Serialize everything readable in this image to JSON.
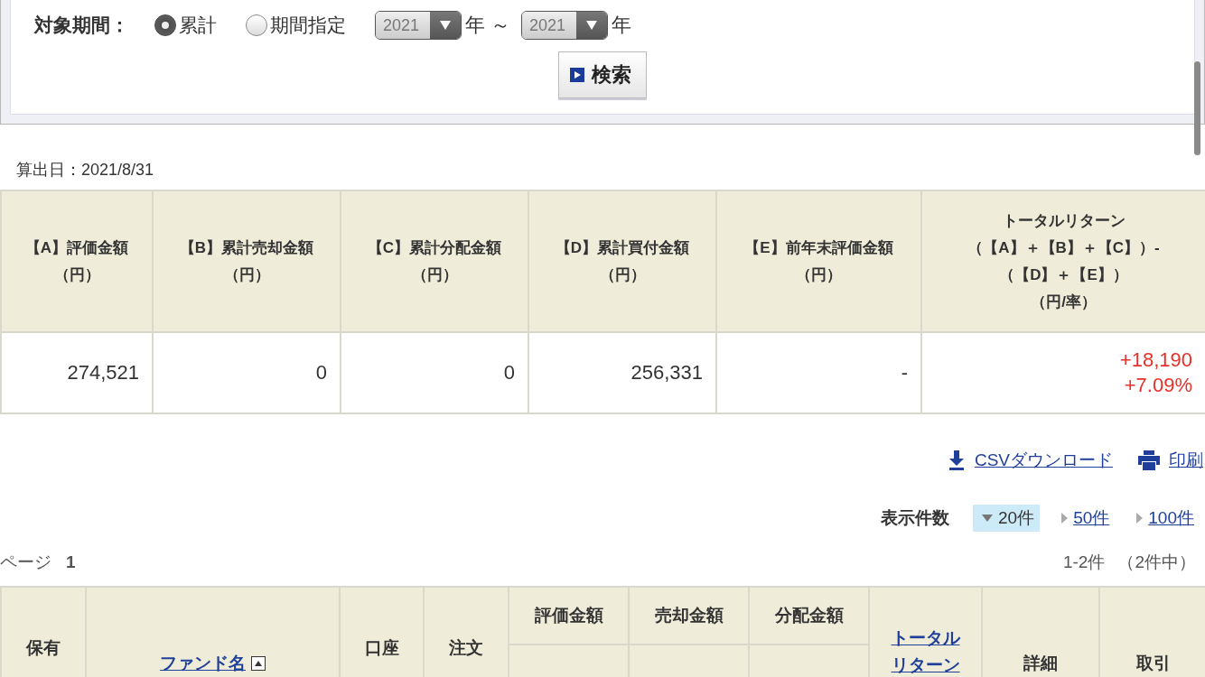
{
  "filter": {
    "label": "対象期間：",
    "options": [
      {
        "label": "累計",
        "selected": true
      },
      {
        "label": "期間指定",
        "selected": false
      }
    ],
    "from_year": "2021",
    "from_unit": "年",
    "separator": "～",
    "to_year": "2021",
    "to_unit": "年",
    "search_button": "検索"
  },
  "calc_date": "算出日：2021/8/31",
  "summary": {
    "columns": [
      {
        "lines": [
          "【A】評価金額",
          "（円）"
        ]
      },
      {
        "lines": [
          "【B】累計売却金額",
          "（円）"
        ]
      },
      {
        "lines": [
          "【C】累計分配金額",
          "（円）"
        ]
      },
      {
        "lines": [
          "【D】累計買付金額",
          "（円）"
        ]
      },
      {
        "lines": [
          "【E】前年末評価金額",
          "（円）"
        ]
      },
      {
        "lines": [
          "トータルリターン",
          "（【A】＋【B】＋【C】）-",
          "（【D】＋【E】）",
          "（円/率）"
        ]
      }
    ],
    "row": [
      {
        "kind": "plain",
        "lines": [
          "274,521"
        ]
      },
      {
        "kind": "plain",
        "lines": [
          "0"
        ]
      },
      {
        "kind": "plain",
        "lines": [
          "0"
        ]
      },
      {
        "kind": "plain",
        "lines": [
          "256,331"
        ]
      },
      {
        "kind": "plain",
        "lines": [
          "-"
        ]
      },
      {
        "kind": "gain",
        "lines": [
          "+18,190",
          "+7.09%"
        ]
      }
    ]
  },
  "actions": [
    {
      "kind": "download",
      "label": "CSVダウンロード"
    },
    {
      "kind": "print",
      "label": "印刷"
    }
  ],
  "page_size": {
    "label": "表示件数",
    "options": [
      {
        "label": "20件",
        "selected": true
      },
      {
        "label": "50件",
        "selected": false
      },
      {
        "label": "100件",
        "selected": false
      }
    ]
  },
  "pager": {
    "label": "ページ",
    "current": "1",
    "range": "1-2件",
    "total": "（2件中）"
  },
  "fund_table": {
    "columns": [
      {
        "lines": [
          "保有"
        ],
        "link": false
      },
      {
        "lines": [
          "ファンド名"
        ],
        "link": true,
        "sort": true
      },
      {
        "lines": [
          "口座"
        ],
        "link": false
      },
      {
        "lines": [
          "注文"
        ],
        "link": false
      },
      {
        "lines": [
          "評価金額"
        ],
        "link": false,
        "split": true
      },
      {
        "lines": [
          "売却金額"
        ],
        "link": false,
        "split": true
      },
      {
        "lines": [
          "分配金額"
        ],
        "link": false,
        "split": true
      },
      {
        "lines": [
          "トータル",
          "リターン"
        ],
        "link": true
      },
      {
        "lines": [
          "詳細"
        ],
        "link": false
      },
      {
        "lines": [
          "取引"
        ],
        "link": false
      }
    ]
  }
}
